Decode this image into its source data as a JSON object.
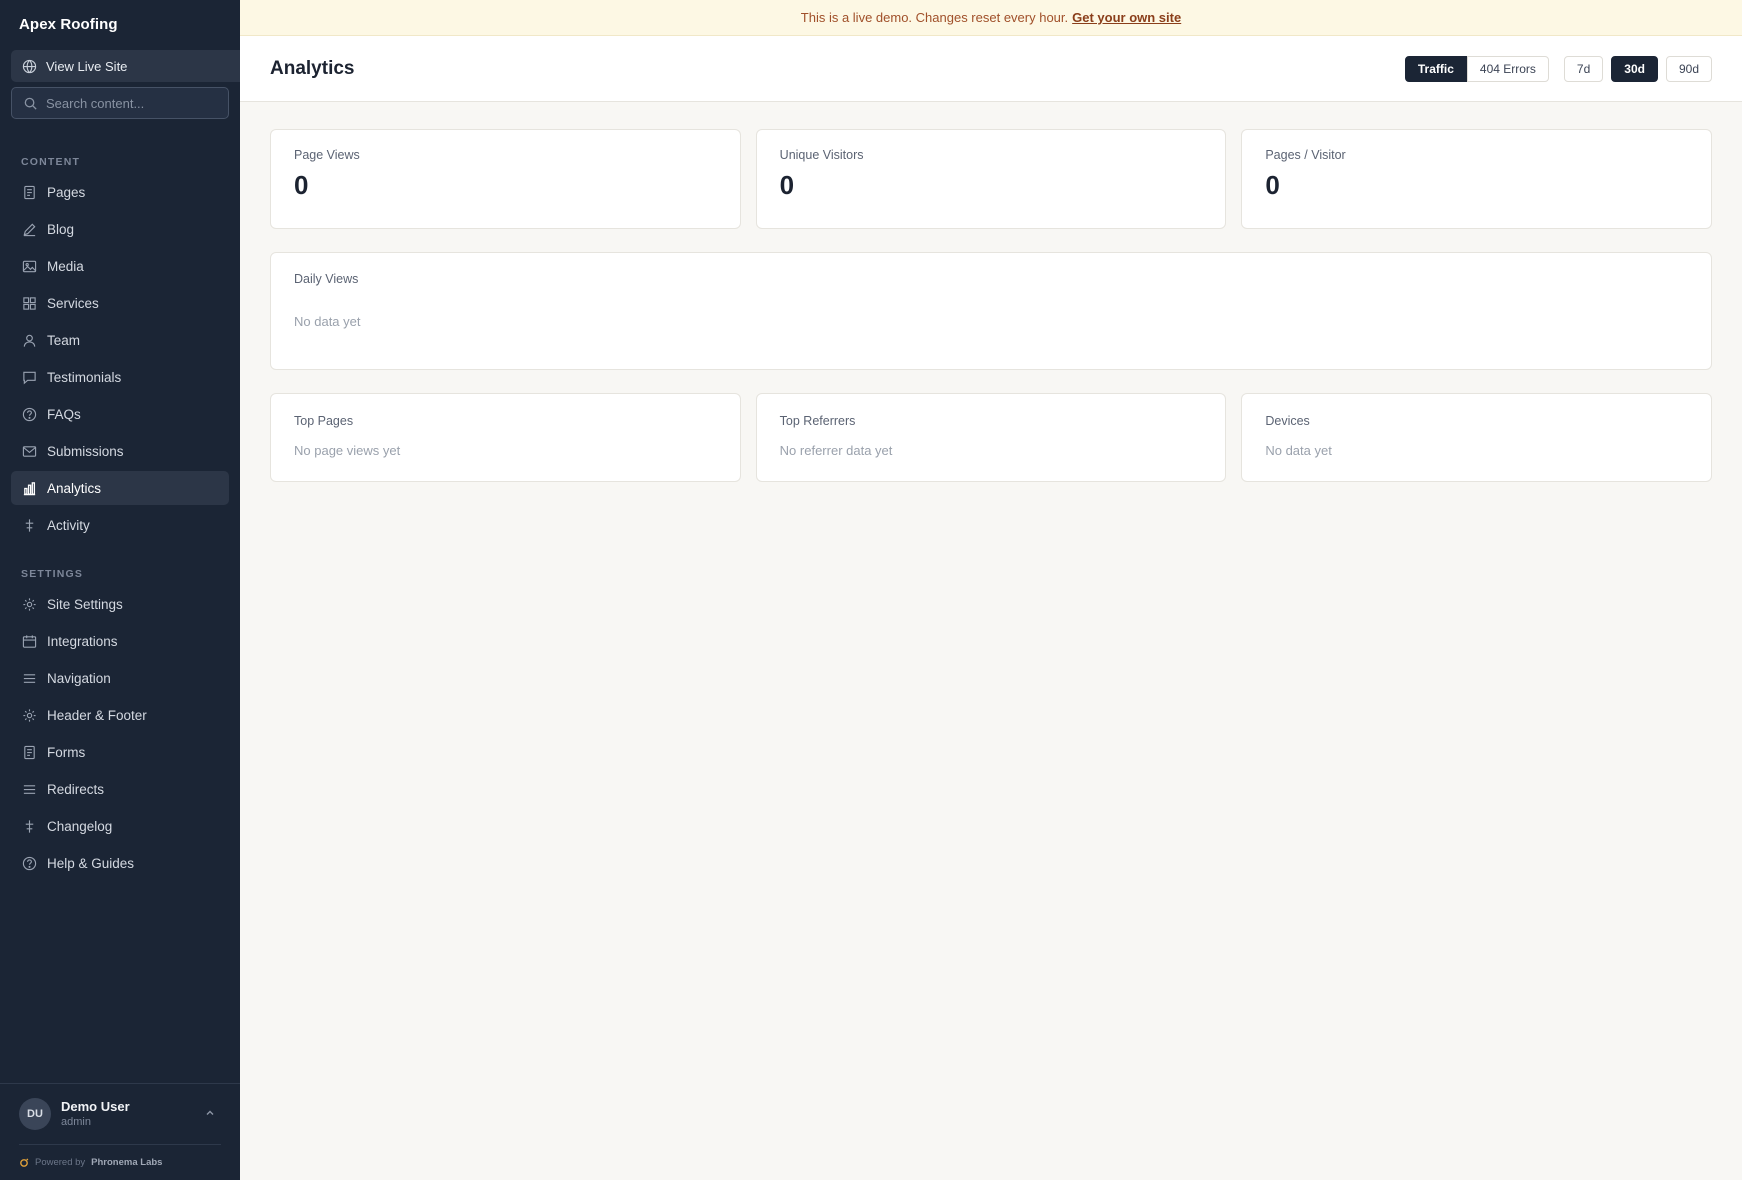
{
  "app": {
    "name": "Apex Roofing"
  },
  "sidebar": {
    "view_live": "View Live Site",
    "search_placeholder": "Search content...",
    "content_label": "CONTENT",
    "settings_label": "SETTINGS",
    "content_items": [
      {
        "label": "Pages",
        "icon": "page-icon"
      },
      {
        "label": "Blog",
        "icon": "pencil-icon"
      },
      {
        "label": "Media",
        "icon": "image-icon"
      },
      {
        "label": "Services",
        "icon": "grid-icon"
      },
      {
        "label": "Team",
        "icon": "user-icon"
      },
      {
        "label": "Testimonials",
        "icon": "chat-icon"
      },
      {
        "label": "FAQs",
        "icon": "question-icon"
      },
      {
        "label": "Submissions",
        "icon": "mail-icon"
      },
      {
        "label": "Analytics",
        "icon": "bar-chart-icon",
        "active": true
      },
      {
        "label": "Activity",
        "icon": "activity-icon"
      }
    ],
    "settings_items": [
      {
        "label": "Site Settings",
        "icon": "gear-icon"
      },
      {
        "label": "Integrations",
        "icon": "calendar-icon"
      },
      {
        "label": "Navigation",
        "icon": "menu-icon"
      },
      {
        "label": "Header & Footer",
        "icon": "gear-icon"
      },
      {
        "label": "Forms",
        "icon": "form-icon"
      },
      {
        "label": "Redirects",
        "icon": "menu-icon"
      },
      {
        "label": "Changelog",
        "icon": "activity-icon"
      },
      {
        "label": "Help & Guides",
        "icon": "help-icon"
      }
    ],
    "user": {
      "initials": "DU",
      "name": "Demo User",
      "role": "admin"
    },
    "powered_prefix": "Powered by",
    "powered_brand": "Phronema Labs"
  },
  "banner": {
    "text": "This is a live demo. Changes reset every hour.",
    "link": "Get your own site"
  },
  "header": {
    "title": "Analytics",
    "view_tabs": [
      {
        "label": "Traffic",
        "selected": true
      },
      {
        "label": "404 Errors",
        "selected": false
      }
    ],
    "ranges": [
      {
        "label": "7d",
        "selected": false
      },
      {
        "label": "30d",
        "selected": true
      },
      {
        "label": "90d",
        "selected": false
      }
    ]
  },
  "stats": [
    {
      "label": "Page Views",
      "value": "0"
    },
    {
      "label": "Unique Visitors",
      "value": "0"
    },
    {
      "label": "Pages / Visitor",
      "value": "0"
    }
  ],
  "daily": {
    "title": "Daily Views",
    "empty": "No data yet"
  },
  "panels": [
    {
      "title": "Top Pages",
      "empty": "No page views yet"
    },
    {
      "title": "Top Referrers",
      "empty": "No referrer data yet"
    },
    {
      "title": "Devices",
      "empty": "No data yet"
    }
  ],
  "colors": {
    "sidebar_bg": "#1b2535",
    "accent_dark": "#1b2535",
    "banner_bg": "#fdf8e4",
    "banner_text": "#a0502a",
    "page_bg": "#f8f7f4"
  }
}
